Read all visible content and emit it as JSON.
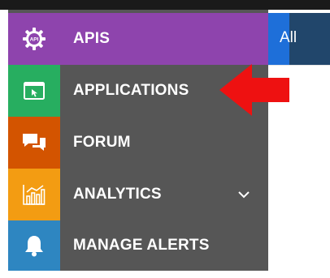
{
  "sidebar": {
    "items": [
      {
        "label": "APIS",
        "icon": "api-gear-icon"
      },
      {
        "label": "APPLICATIONS",
        "icon": "browser-window-icon"
      },
      {
        "label": "FORUM",
        "icon": "chat-bubbles-icon"
      },
      {
        "label": "ANALYTICS",
        "icon": "bar-chart-icon",
        "has_submenu": true
      },
      {
        "label": "MANAGE ALERTS",
        "icon": "bell-icon"
      }
    ]
  },
  "header": {
    "filter_label": "All"
  },
  "annotation": {
    "arrow_color": "#ee1111"
  },
  "colors": {
    "apis": "#8e44ad",
    "applications": "#27ae60",
    "forum": "#d35400",
    "analytics": "#f39c12",
    "alerts": "#2e86c1",
    "sidebar_bg": "#565656"
  }
}
